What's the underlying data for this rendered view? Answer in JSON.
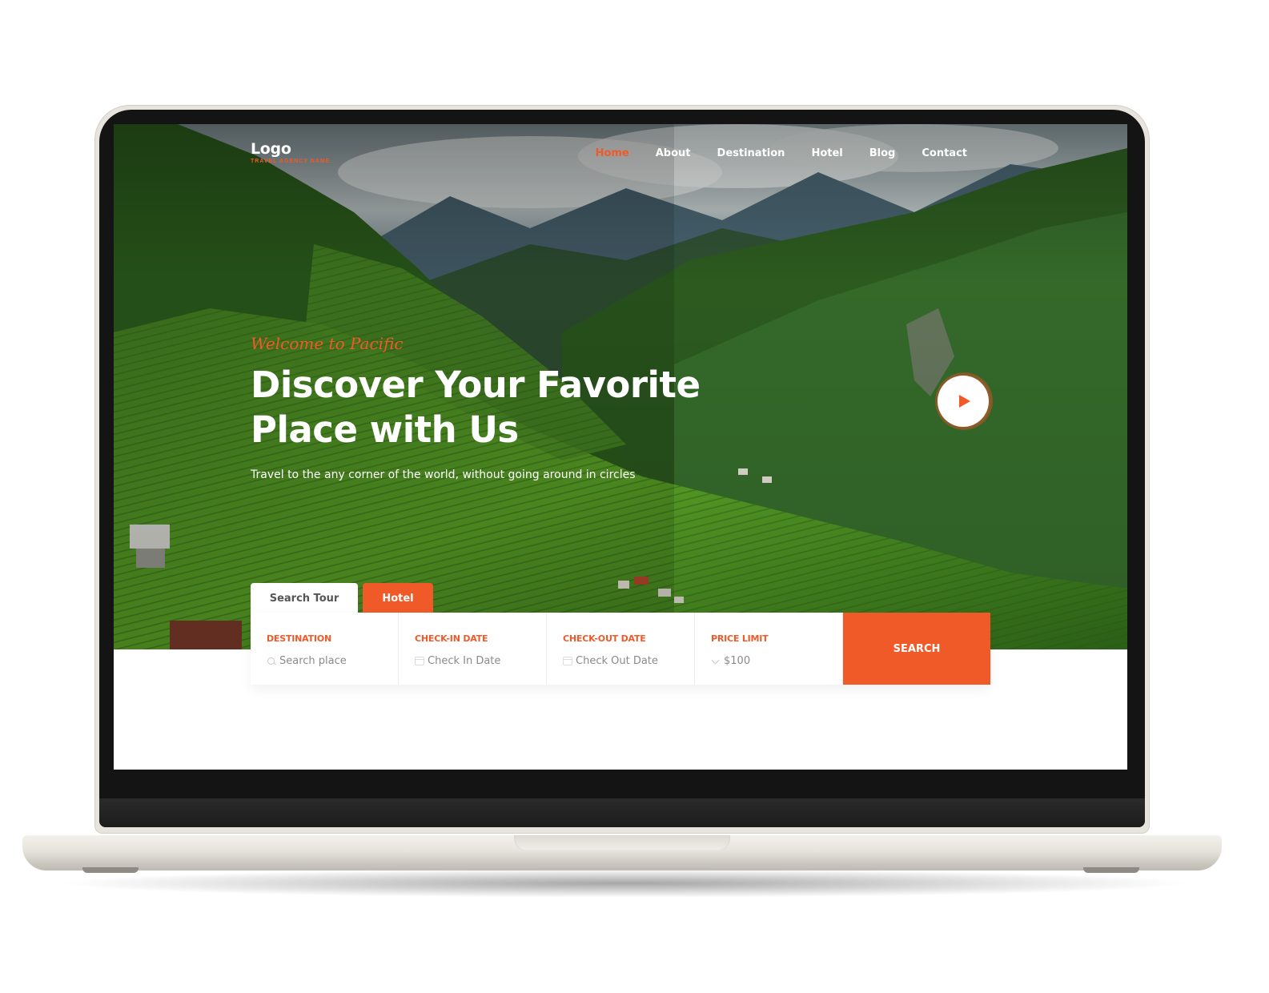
{
  "brand": {
    "logo": "Logo",
    "tagline": "TRAVEL AGENCY NAME",
    "accent_color": "#f05a28"
  },
  "nav": {
    "items": [
      {
        "label": "Home",
        "active": true
      },
      {
        "label": "About",
        "active": false
      },
      {
        "label": "Destination",
        "active": false
      },
      {
        "label": "Hotel",
        "active": false
      },
      {
        "label": "Blog",
        "active": false
      },
      {
        "label": "Contact",
        "active": false
      }
    ]
  },
  "hero": {
    "welcome": "Welcome to Pacific",
    "headline_line1": "Discover Your Favorite",
    "headline_line2": "Place with Us",
    "subtitle": "Travel to the any corner of the world, without going around in circles",
    "play_icon": "play-icon",
    "background": "rice-terraces-mountains"
  },
  "booking": {
    "tabs": [
      {
        "label": "Search Tour",
        "active": false
      },
      {
        "label": "Hotel",
        "active": true
      }
    ],
    "fields": [
      {
        "label": "DESTINATION",
        "placeholder": "Search place",
        "icon": "search-icon"
      },
      {
        "label": "CHECK-IN DATE",
        "placeholder": "Check In Date",
        "icon": "calendar-icon"
      },
      {
        "label": "CHECK-OUT DATE",
        "placeholder": "Check Out Date",
        "icon": "calendar-icon"
      },
      {
        "label": "PRICE LIMIT",
        "value": "$100",
        "icon": "chevron-down-icon"
      }
    ],
    "search_label": "SEARCH"
  }
}
